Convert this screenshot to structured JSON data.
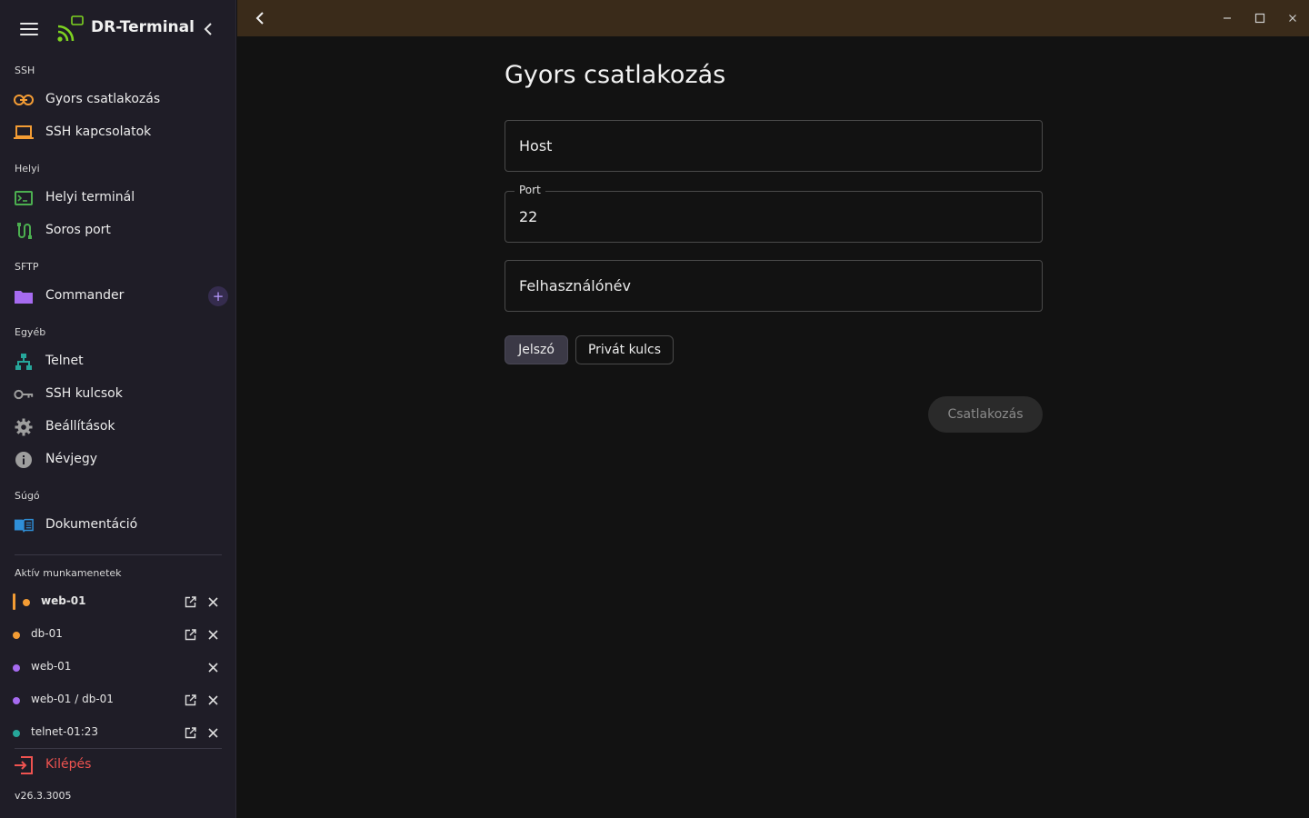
{
  "app": {
    "name": "DR-Terminal",
    "version": "v26.3.3005"
  },
  "colors": {
    "accent": "#b89aff",
    "active": "#f39c34",
    "danger": "#ef5350",
    "titlebar": "#3a2b1a"
  },
  "sidebar": {
    "sections": {
      "ssh": "SSH",
      "local": "Helyi",
      "sftp": "SFTP",
      "other": "Egyéb",
      "help": "Súgó",
      "sessions": "Aktív munkamenetek"
    },
    "items": {
      "quick_connect": {
        "label": "Gyors csatlakozás",
        "icon": "link-icon"
      },
      "ssh_connections": {
        "label": "SSH kapcsolatok",
        "icon": "laptop-icon"
      },
      "local_terminal": {
        "label": "Helyi terminál",
        "icon": "terminal-icon"
      },
      "serial_port": {
        "label": "Soros port",
        "icon": "cable-icon"
      },
      "commander": {
        "label": "Commander",
        "icon": "folder-icon",
        "add": "+"
      },
      "telnet": {
        "label": "Telnet",
        "icon": "network-icon"
      },
      "ssh_keys": {
        "label": "SSH kulcsok",
        "icon": "key-icon"
      },
      "settings": {
        "label": "Beállítások",
        "icon": "gear-icon"
      },
      "about": {
        "label": "Névjegy",
        "icon": "info-icon"
      },
      "docs": {
        "label": "Dokumentáció",
        "icon": "book-icon"
      }
    },
    "sessions": [
      {
        "name": "web-01",
        "color": "#f39c34",
        "active": true
      },
      {
        "name": "db-01",
        "color": "#f39c34"
      },
      {
        "name": "web-01",
        "color": "#a66bf0"
      },
      {
        "name": "web-01 / db-01",
        "color": "#a66bf0"
      },
      {
        "name": "telnet-01:23",
        "color": "#26a69a"
      }
    ],
    "logout": "Kilépés"
  },
  "main": {
    "title": "Gyors csatlakozás",
    "host": {
      "placeholder": "Host",
      "value": ""
    },
    "port": {
      "label": "Port",
      "value": "22"
    },
    "username": {
      "placeholder": "Felhasználónév",
      "value": ""
    },
    "auth": {
      "password": "Jelszó",
      "private_key": "Privát kulcs",
      "selected": "Jelszó"
    },
    "connect": "Csatlakozás"
  }
}
